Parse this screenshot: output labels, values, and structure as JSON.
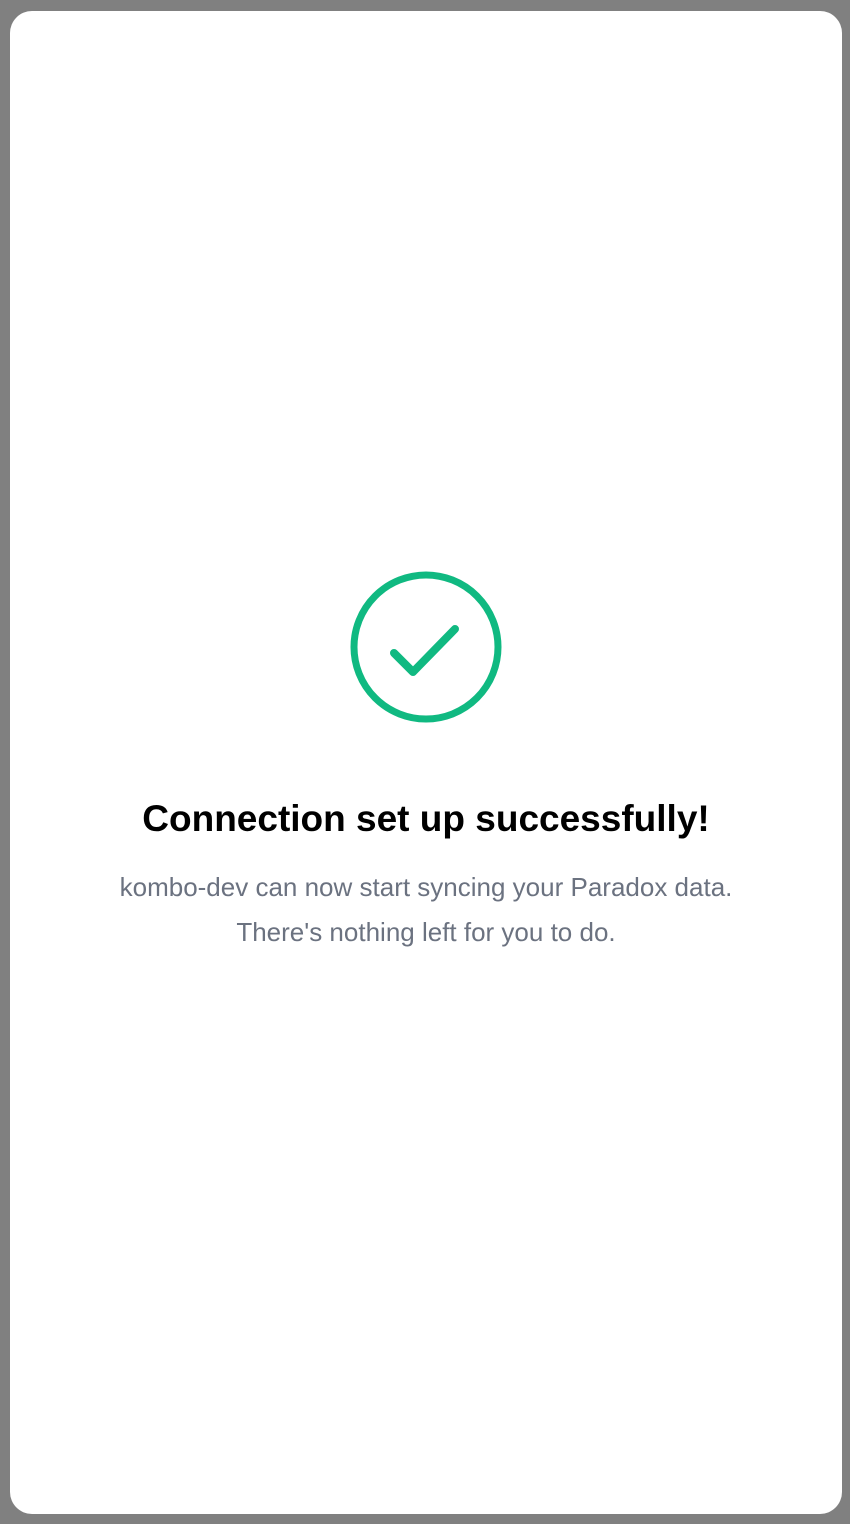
{
  "status": {
    "icon": "check-circle-icon",
    "accent_color": "#10b981",
    "title": "Connection set up successfully!",
    "description_line1": "kombo-dev can now start syncing your Paradox data.",
    "description_line2": "There's nothing left for you to do."
  },
  "colors": {
    "backdrop": "#808080",
    "card": "#ffffff",
    "title_text": "#000000",
    "body_text": "#6b7280"
  }
}
